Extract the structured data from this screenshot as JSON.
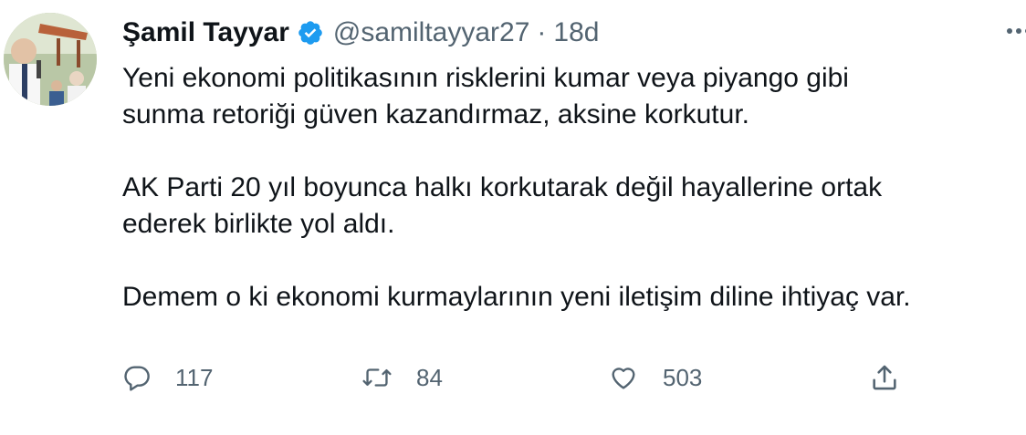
{
  "tweet": {
    "author": {
      "name": "Şamil Tayyar",
      "handle": "@samiltayyar27",
      "separator": "·",
      "age": "18d",
      "verified": true
    },
    "text": {
      "paragraph_1": "Yeni ekonomi politikasının risklerini kumar veya piyango gibi\nsunma retoriği güven kazandırmaz, aksine korkutur.",
      "paragraph_2": "AK Parti 20 yıl boyunca halkı korkutarak değil hayallerine ortak\nederek birlikte yol aldı.",
      "paragraph_3": "Demem o ki ekonomi kurmaylarının yeni iletişim diline ihtiyaç var."
    },
    "actions": {
      "reply": {
        "icon": "reply-icon",
        "count": "117"
      },
      "retweet": {
        "icon": "retweet-icon",
        "count": "84"
      },
      "like": {
        "icon": "heart-icon",
        "count": "503"
      },
      "share": {
        "icon": "share-icon"
      }
    }
  },
  "colors": {
    "text_primary": "#0f1419",
    "text_secondary": "#536471",
    "verified_blue": "#1d9bf0"
  }
}
